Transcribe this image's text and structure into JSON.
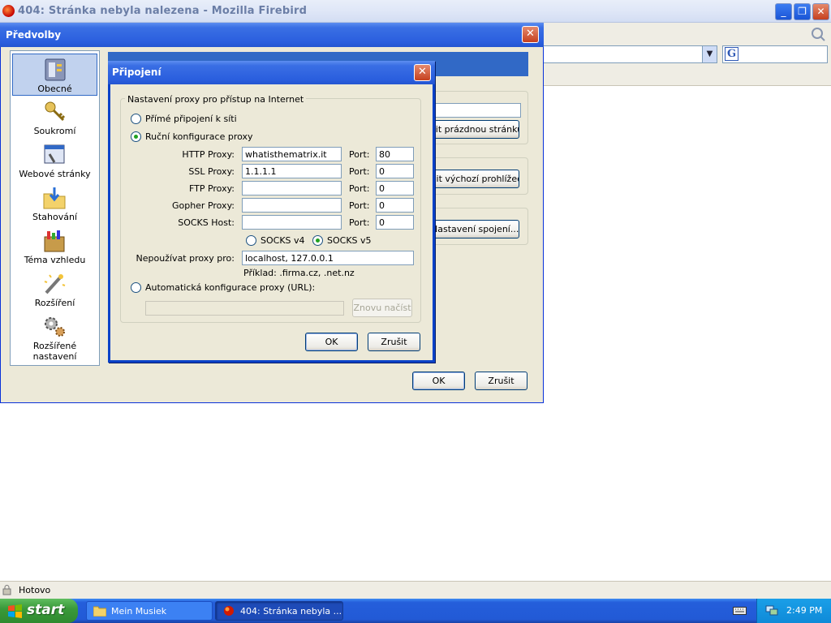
{
  "window": {
    "title": "404: Stránka nebyla nalezena - Mozilla Firebird"
  },
  "status": {
    "text": "Hotovo"
  },
  "taskbar": {
    "start": "start",
    "tasks": [
      {
        "label": "Mein Musiek"
      },
      {
        "label": "404: Stránka nebyla ..."
      }
    ],
    "clock": "2:49 PM"
  },
  "prefs": {
    "title": "Předvolby",
    "categories": [
      {
        "label": "Obecné",
        "icon": "general-icon"
      },
      {
        "label": "Soukromí",
        "icon": "keys-icon"
      },
      {
        "label": "Webové stránky",
        "icon": "web-features-icon"
      },
      {
        "label": "Stahování",
        "icon": "downloads-icon"
      },
      {
        "label": "Téma vzhledu",
        "icon": "themes-icon"
      },
      {
        "label": "Rozšíření",
        "icon": "extensions-icon"
      },
      {
        "label": "Rozšířené nastavení",
        "icon": "advanced-icon"
      }
    ],
    "behind_buttons": {
      "blank_page": "žit prázdnou stránku",
      "default_browser": "vit výchozí prohlížeč",
      "connection_settings": "Nastavení spojení..."
    },
    "ok": "OK",
    "cancel": "Zrušit"
  },
  "connection": {
    "title": "Připojení",
    "group_label": "Nastavení proxy pro přístup na Internet",
    "direct_label": "Přímé připojení k síti",
    "manual_label": "Ruční konfigurace proxy",
    "rows": [
      {
        "label": "HTTP Proxy:",
        "value": "whatisthematrix.it",
        "port_label": "Port:",
        "port": "80"
      },
      {
        "label": "SSL Proxy:",
        "value": "1.1.1.1",
        "port_label": "Port:",
        "port": "0"
      },
      {
        "label": "FTP Proxy:",
        "value": "",
        "port_label": "Port:",
        "port": "0"
      },
      {
        "label": "Gopher Proxy:",
        "value": "",
        "port_label": "Port:",
        "port": "0"
      },
      {
        "label": "SOCKS Host:",
        "value": "",
        "port_label": "Port:",
        "port": "0"
      }
    ],
    "socks_v4": "SOCKS v4",
    "socks_v5": "SOCKS v5",
    "no_proxy_label": "Nepoužívat proxy pro:",
    "no_proxy_value": "localhost, 127.0.0.1",
    "example": "Příklad: .firma.cz, .net.nz",
    "auto_label": "Automatická konfigurace proxy (URL):",
    "auto_url": "",
    "reload": "Znovu načíst",
    "ok": "OK",
    "cancel": "Zrušit",
    "selected_mode": "manual",
    "socks_version": "v5"
  },
  "colors": {
    "xp_blue": "#2a5ede",
    "dialog_bg": "#ece9d8",
    "close_red": "#c6401f"
  }
}
